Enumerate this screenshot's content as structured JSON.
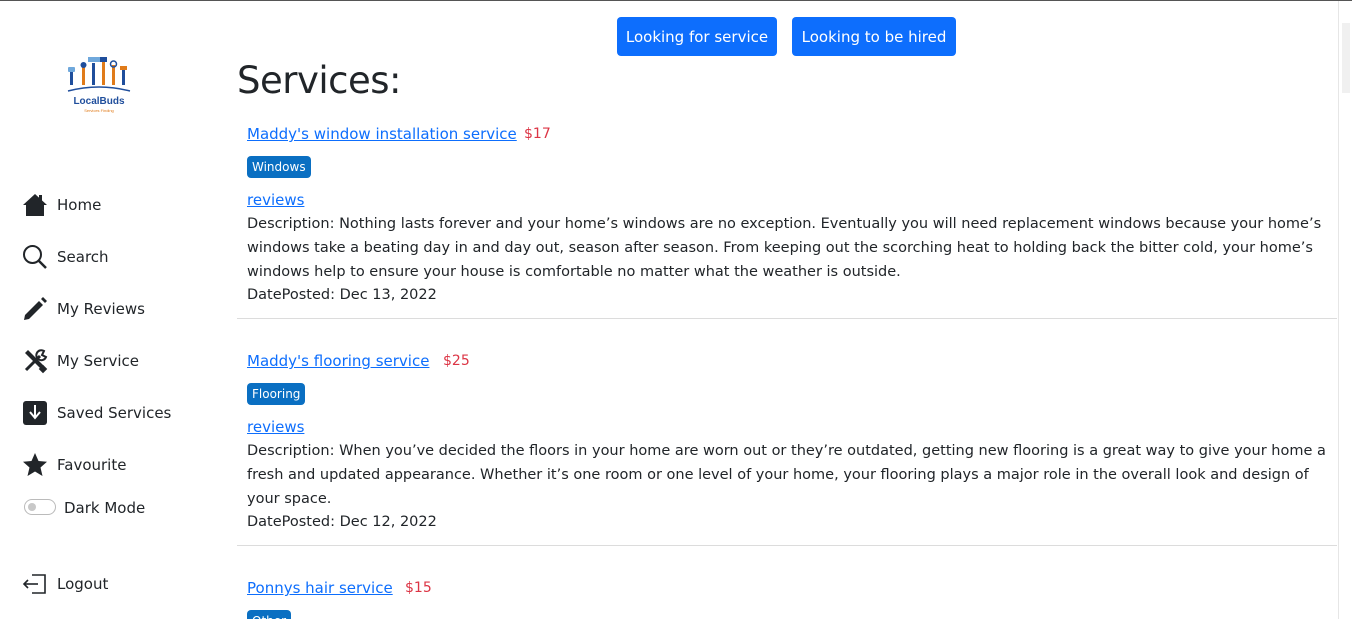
{
  "brand": {
    "name": "LocalBuds",
    "tagline": "Services Finding"
  },
  "sidebar": {
    "items": [
      {
        "label": "Home",
        "icon": "house-icon"
      },
      {
        "label": "Search",
        "icon": "search-icon"
      },
      {
        "label": "My Reviews",
        "icon": "pencil-icon"
      },
      {
        "label": "My Service",
        "icon": "tools-icon"
      },
      {
        "label": "Saved Services",
        "icon": "download-box-icon"
      },
      {
        "label": "Favourite",
        "icon": "star-icon"
      }
    ],
    "dark_mode": {
      "label": "Dark Mode",
      "enabled": false
    },
    "logout": {
      "label": "Logout",
      "icon": "logout-icon"
    }
  },
  "header": {
    "btn_service": "Looking for service",
    "btn_hired": "Looking to be hired"
  },
  "main": {
    "title": "Services:",
    "services": [
      {
        "name": "Maddy's window installation service",
        "price": "$17",
        "category": "Windows",
        "reviews_label": "reviews",
        "description": "Description: Nothing lasts forever and your home’s windows are no exception. Eventually you will need replacement windows because your home’s windows take a beating day in and day out, season after season. From keeping out the scorching heat to holding back the bitter cold, your home’s windows help to ensure your house is comfortable no matter what the weather is outside.",
        "date": "DatePosted: Dec 13, 2022"
      },
      {
        "name": "Maddy's flooring service",
        "price": "$25",
        "category": "Flooring",
        "reviews_label": "reviews",
        "description": "Description: When you’ve decided the floors in your home are worn out or they’re outdated, getting new flooring is a great way to give your home a fresh and updated appearance. Whether it’s one room or one level of your home, your flooring plays a major role in the overall look and design of your space.",
        "date": "DatePosted: Dec 12, 2022"
      },
      {
        "name": "Ponnys hair service",
        "price": "$15",
        "category": "Other"
      }
    ]
  },
  "colors": {
    "primary": "#0d6efd",
    "badge": "#0a6fc2",
    "price": "#dc3545",
    "text": "#212529"
  }
}
